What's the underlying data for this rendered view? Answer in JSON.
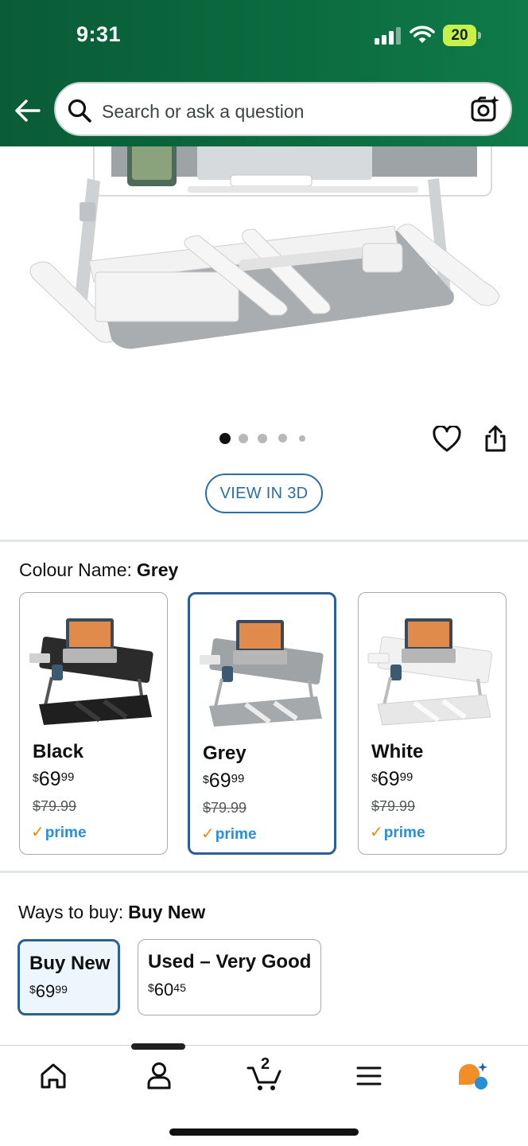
{
  "status_bar": {
    "time": "9:31",
    "battery": "20"
  },
  "search": {
    "placeholder": "Search or ask a question"
  },
  "gallery": {
    "image_count": 5,
    "active_index": 0,
    "view_3d_label": "VIEW IN 3D"
  },
  "colour": {
    "label": "Colour Name:",
    "selected": "Grey",
    "options": [
      {
        "name": "Black",
        "currency": "$",
        "price_whole": "69",
        "price_cents": "99",
        "old_price": "$79.99",
        "prime": "prime"
      },
      {
        "name": "Grey",
        "currency": "$",
        "price_whole": "69",
        "price_cents": "99",
        "old_price": "$79.99",
        "prime": "prime"
      },
      {
        "name": "White",
        "currency": "$",
        "price_whole": "69",
        "price_cents": "99",
        "old_price": "$79.99",
        "prime": "prime"
      }
    ]
  },
  "ways_to_buy": {
    "label": "Ways to buy:",
    "selected": "Buy New",
    "options": [
      {
        "title": "Buy New",
        "currency": "$",
        "price_whole": "69",
        "price_cents": "99"
      },
      {
        "title": "Used – Very Good",
        "currency": "$",
        "price_whole": "60",
        "price_cents": "45"
      }
    ]
  },
  "bottom_nav": {
    "items": [
      "home-icon",
      "account-icon",
      "cart-icon",
      "menu-icon",
      "rufus-icon"
    ],
    "cart_count": "2"
  },
  "colors": {
    "header": "#0b6b3f",
    "accent_blue": "#2c5f95",
    "prime_blue": "#2a8fd6",
    "prime_check": "#f08b00"
  }
}
